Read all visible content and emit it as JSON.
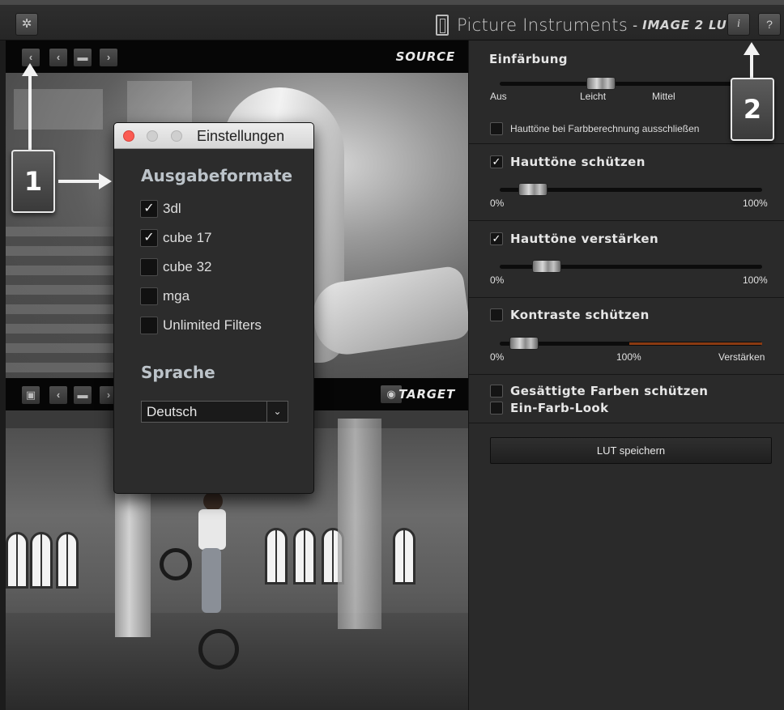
{
  "app": {
    "brand_name": "Picture Instruments",
    "brand_separator": "-",
    "product_name": "IMAGE 2 LUT",
    "info_label": "i",
    "help_label": "?"
  },
  "source_bar": {
    "label": "SOURCE"
  },
  "target_bar": {
    "label": "TARGET"
  },
  "settings_dialog": {
    "title": "Einstellungen",
    "output_heading": "Ausgabeformate",
    "formats": [
      {
        "label": "3dl",
        "checked": true
      },
      {
        "label": "cube 17",
        "checked": true
      },
      {
        "label": "cube 32",
        "checked": false
      },
      {
        "label": "mga",
        "checked": false
      },
      {
        "label": "Unlimited Filters",
        "checked": false
      }
    ],
    "language_heading": "Sprache",
    "language_value": "Deutsch"
  },
  "panel": {
    "tint": {
      "title": "Einfärbung",
      "labels": [
        "Aus",
        "Leicht",
        "Mittel"
      ],
      "value": 0.37,
      "exclude_skin_label": "Hauttöne bei Farbberechnung ausschließen",
      "exclude_skin_checked": false
    },
    "protect_skin": {
      "title": "Hauttöne schützen",
      "checked": true,
      "min_label": "0%",
      "max_label": "100%",
      "value": 0.08
    },
    "boost_skin": {
      "title": "Hauttöne verstärken",
      "checked": true,
      "min_label": "0%",
      "max_label": "100%",
      "value": 0.14
    },
    "protect_contrast": {
      "title": "Kontraste schützen",
      "checked": false,
      "min_label": "0%",
      "mid_label": "100%",
      "max_label": "Verstärken",
      "value": 0.04
    },
    "protect_saturated": {
      "title": "Gesättigte Farben schützen",
      "checked": false
    },
    "single_color": {
      "title": "Ein-Farb-Look",
      "checked": false
    },
    "save_button": "LUT speichern"
  },
  "callouts": {
    "one": "1",
    "two": "2"
  },
  "icons": {
    "gear": "gear-icon",
    "prev": "chevron-left-icon",
    "next": "chevron-right-icon",
    "folder": "folder-icon",
    "eye": "eye-icon",
    "save": "save-icon",
    "checkmark": "✓"
  }
}
